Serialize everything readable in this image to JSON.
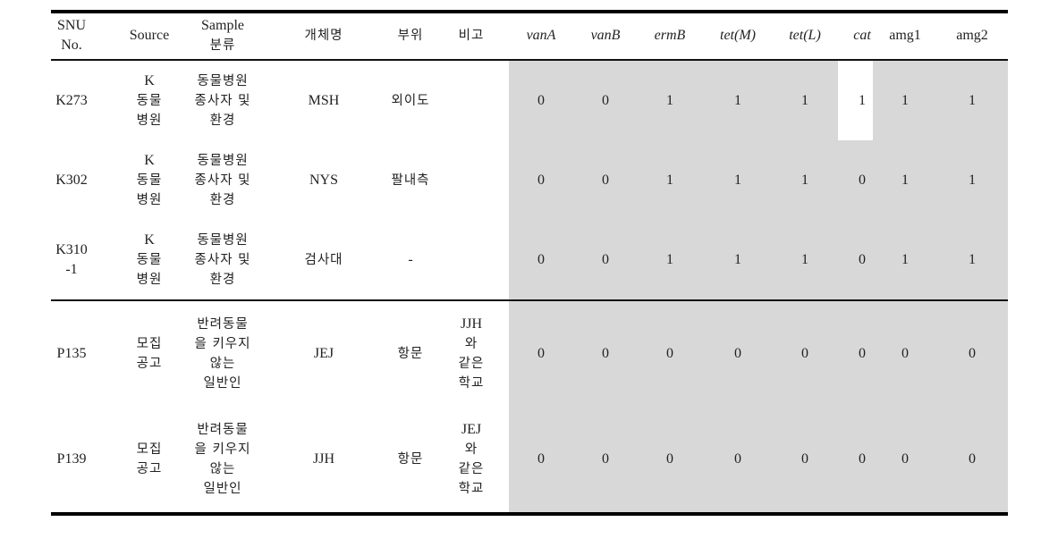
{
  "table": {
    "headers": [
      {
        "key": "snu_no",
        "lines": [
          "SNU",
          "No."
        ],
        "italic": false
      },
      {
        "key": "source",
        "lines": [
          "Source"
        ],
        "italic": false
      },
      {
        "key": "sample_class",
        "lines": [
          "Sample",
          "분류"
        ],
        "italic": false
      },
      {
        "key": "individual",
        "lines": [
          "개체명"
        ],
        "italic": false
      },
      {
        "key": "site",
        "lines": [
          "부위"
        ],
        "italic": false
      },
      {
        "key": "remarks",
        "lines": [
          "비고"
        ],
        "italic": false
      },
      {
        "key": "vanA",
        "lines": [
          "vanA"
        ],
        "italic": true
      },
      {
        "key": "vanB",
        "lines": [
          "vanB"
        ],
        "italic": true
      },
      {
        "key": "ermB",
        "lines": [
          "ermB"
        ],
        "italic": true
      },
      {
        "key": "tetM",
        "lines": [
          "tet(M)"
        ],
        "italic": true
      },
      {
        "key": "tetL",
        "lines": [
          "tet(L)"
        ],
        "italic": true
      },
      {
        "key": "cat",
        "lines": [
          "cat"
        ],
        "italic": true
      },
      {
        "key": "amg1",
        "lines": [
          "amg1"
        ],
        "italic": false
      },
      {
        "key": "amg2",
        "lines": [
          "amg2"
        ],
        "italic": false
      }
    ],
    "rows": [
      {
        "snu_no": [
          "K273"
        ],
        "source": [
          "K",
          "동물",
          "병원"
        ],
        "sample_class": [
          "동물병원",
          "종사자 및",
          "환경"
        ],
        "individual": [
          "MSH"
        ],
        "site": [
          "외이도"
        ],
        "remarks": [],
        "genes": [
          "0",
          "0",
          "1",
          "1",
          "1",
          "1",
          "1",
          "1"
        ]
      },
      {
        "snu_no": [
          "K302"
        ],
        "source": [
          "K",
          "동물",
          "병원"
        ],
        "sample_class": [
          "동물병원",
          "종사자 및",
          "환경"
        ],
        "individual": [
          "NYS"
        ],
        "site": [
          "팔내측"
        ],
        "remarks": [],
        "genes": [
          "0",
          "0",
          "1",
          "1",
          "1",
          "0",
          "1",
          "1"
        ]
      },
      {
        "snu_no": [
          "K310",
          "-1"
        ],
        "source": [
          "K",
          "동물",
          "병원"
        ],
        "sample_class": [
          "동물병원",
          "종사자 및",
          "환경"
        ],
        "individual": [
          "검사대"
        ],
        "site": [
          "-"
        ],
        "remarks": [],
        "genes": [
          "0",
          "0",
          "1",
          "1",
          "1",
          "0",
          "1",
          "1"
        ]
      },
      {
        "snu_no": [
          "P135"
        ],
        "source": [
          "모집",
          "공고"
        ],
        "sample_class": [
          "반려동물",
          "을 키우지",
          "않는",
          "일반인"
        ],
        "individual": [
          "JEJ"
        ],
        "site": [
          "항문"
        ],
        "remarks": [
          "JJH",
          "와",
          "같은",
          "학교"
        ],
        "genes": [
          "0",
          "0",
          "0",
          "0",
          "0",
          "0",
          "0",
          "0"
        ]
      },
      {
        "snu_no": [
          "P139"
        ],
        "source": [
          "모집",
          "공고"
        ],
        "sample_class": [
          "반려동물",
          "을 키우지",
          "않는",
          "일반인"
        ],
        "individual": [
          "JJH"
        ],
        "site": [
          "항문"
        ],
        "remarks": [
          "JEJ",
          "와",
          "같은",
          "학교"
        ],
        "genes": [
          "0",
          "0",
          "0",
          "0",
          "0",
          "0",
          "0",
          "0"
        ]
      }
    ],
    "highlight": {
      "shade_color": "#d8d8d8",
      "unshaded_cell": {
        "row": 0,
        "column": "cat"
      }
    }
  }
}
